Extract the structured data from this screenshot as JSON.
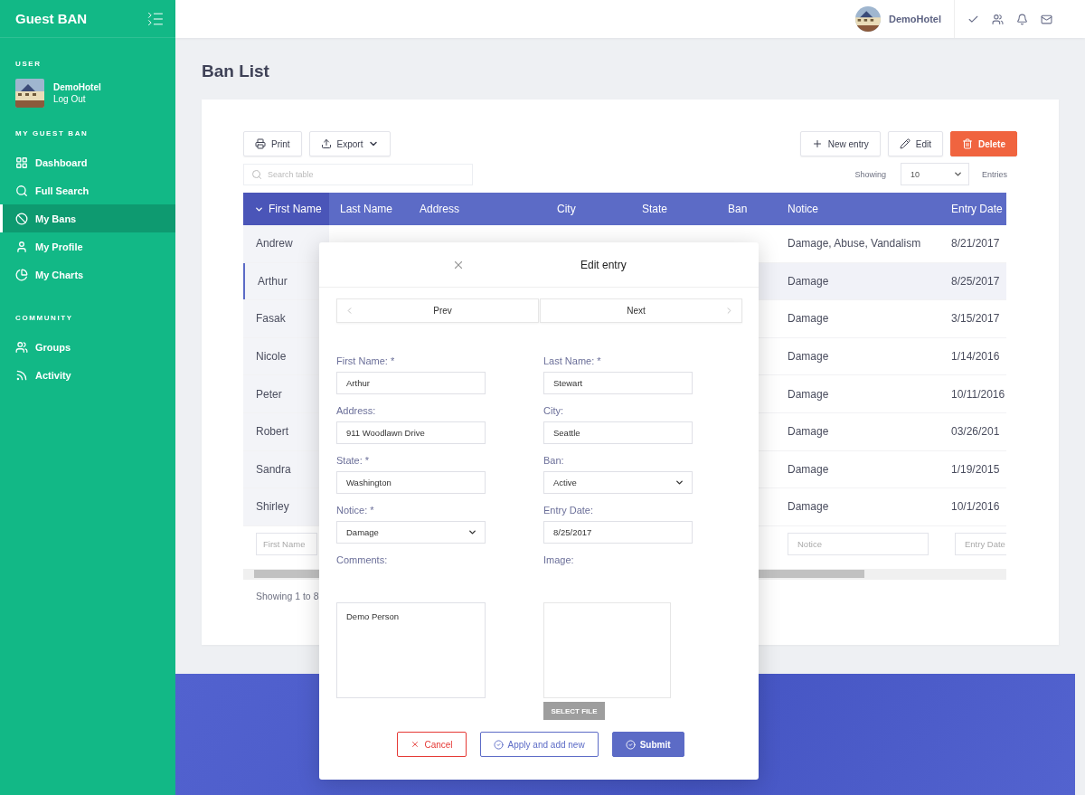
{
  "sidebar": {
    "brand": "Guest BAN",
    "user_section": "USER",
    "user": {
      "name": "DemoHotel",
      "logout": "Log Out"
    },
    "sections": [
      {
        "title": "MY GUEST BAN",
        "items": [
          {
            "label": "Dashboard",
            "selected": false
          },
          {
            "label": "Full Search",
            "selected": false
          },
          {
            "label": "My Bans",
            "selected": true
          },
          {
            "label": "My Profile",
            "selected": false
          },
          {
            "label": "My Charts",
            "selected": false
          }
        ]
      },
      {
        "title": "COMMUNITY",
        "items": [
          {
            "label": "Groups",
            "selected": false
          },
          {
            "label": "Activity",
            "selected": false
          }
        ]
      }
    ]
  },
  "topbar": {
    "user": "DemoHotel"
  },
  "page_title": "Ban List",
  "toolbar": {
    "left_buttons": [
      {
        "label": "Print",
        "kind": "print"
      },
      {
        "label": "Export",
        "kind": "export"
      }
    ],
    "right_buttons": [
      {
        "label": "New entry",
        "kind": "new"
      },
      {
        "label": "Edit",
        "kind": "edit"
      },
      {
        "label": "Delete",
        "kind": "delete"
      }
    ]
  },
  "search": {
    "placeholder": "Search table"
  },
  "page_size": {
    "label": "Showing",
    "value": "10",
    "suffix": "Entries"
  },
  "table": {
    "columns": [
      {
        "label": "First Name",
        "sorted": true
      },
      {
        "label": "Last Name",
        "sorted": false
      },
      {
        "label": "Address",
        "sorted": false
      },
      {
        "label": "City",
        "sorted": false
      },
      {
        "label": "State",
        "sorted": false
      },
      {
        "label": "Ban",
        "sorted": false
      },
      {
        "label": "Notice",
        "sorted": false
      },
      {
        "label": "Entry Date",
        "sorted": false
      }
    ],
    "rows": [
      {
        "first_name": "Andrew",
        "notice": "Damage, Abuse, Vandalism",
        "entry_date": "8/21/2017",
        "selected": false
      },
      {
        "first_name": "Arthur",
        "notice": "Damage",
        "entry_date": "8/25/2017",
        "selected": true
      },
      {
        "first_name": "Fasak",
        "notice": "Damage",
        "entry_date": "3/15/2017",
        "selected": false
      },
      {
        "first_name": "Nicole",
        "notice": "Damage",
        "entry_date": "1/14/2016",
        "selected": false
      },
      {
        "first_name": "Peter",
        "notice": "Damage",
        "entry_date": "10/11/2016",
        "selected": false
      },
      {
        "first_name": "Robert",
        "notice": "Damage",
        "entry_date": "03/26/201",
        "selected": false
      },
      {
        "first_name": "Sandra",
        "notice": "Damage",
        "entry_date": "1/19/2015",
        "selected": false
      },
      {
        "first_name": "Shirley",
        "notice": "Damage",
        "entry_date": "10/1/2016",
        "selected": false
      }
    ],
    "filters": {
      "first_name": "First Name",
      "notice": "Notice",
      "entry_date": "Entry Date"
    }
  },
  "footer_text": "Showing 1 to 8",
  "modal": {
    "title": "Edit entry",
    "prev": "Prev",
    "next": "Next",
    "fields": [
      {
        "label": "First Name: *",
        "value": "Arthur",
        "kind": "text"
      },
      {
        "label": "Last Name: *",
        "value": "Stewart",
        "kind": "text"
      },
      {
        "label": "Address:",
        "value": "911 Woodlawn Drive",
        "kind": "text"
      },
      {
        "label": "City:",
        "value": "Seattle",
        "kind": "text"
      },
      {
        "label": "State: *",
        "value": "Washington",
        "kind": "text"
      },
      {
        "label": "Ban:",
        "value": "Active",
        "kind": "select"
      },
      {
        "label": "Notice: *",
        "value": "Damage",
        "kind": "select"
      },
      {
        "label": "Entry Date:",
        "value": "8/25/2017",
        "kind": "text"
      }
    ],
    "comments": {
      "label": "Comments:",
      "value": "Demo Person"
    },
    "image": {
      "label": "Image:",
      "button": "SELECT FILE"
    },
    "actions": [
      {
        "label": "Cancel",
        "kind": "cancel"
      },
      {
        "label": "Apply and add new",
        "kind": "apply"
      },
      {
        "label": "Submit",
        "kind": "submit"
      }
    ]
  }
}
